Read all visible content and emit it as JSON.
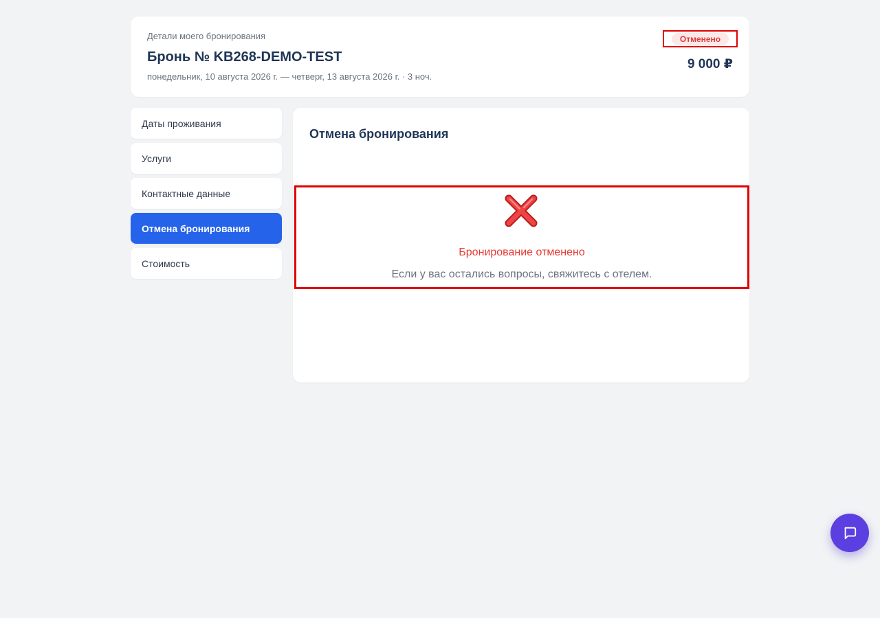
{
  "header": {
    "subtitle": "Детали моего бронирования",
    "booking_title": "Бронь № KB268-DEMO-TEST",
    "dates": "понедельник, 10 августа 2026 г. — четверг, 13 августа 2026 г. · 3 ноч.",
    "status": "Отменено",
    "price": "9 000 ₽"
  },
  "sidebar": {
    "items": [
      {
        "label": "Даты проживания",
        "active": false
      },
      {
        "label": "Услуги",
        "active": false
      },
      {
        "label": "Контактные данные",
        "active": false
      },
      {
        "label": "Отмена бронирования",
        "active": true
      },
      {
        "label": "Стоимость",
        "active": false
      }
    ]
  },
  "main": {
    "section_title": "Отмена бронирования",
    "cancel_title": "Бронирование отменено",
    "cancel_note": "Если у вас остались вопросы, свяжитесь с отелем."
  },
  "chat": {
    "icon": "chat-bubble-icon"
  },
  "colors": {
    "accent": "#2563eb",
    "status_text": "#dc3b3b",
    "status_bg": "#fde8e8",
    "cancel_red": "#e53935",
    "chat_button": "#5b3fe0"
  }
}
